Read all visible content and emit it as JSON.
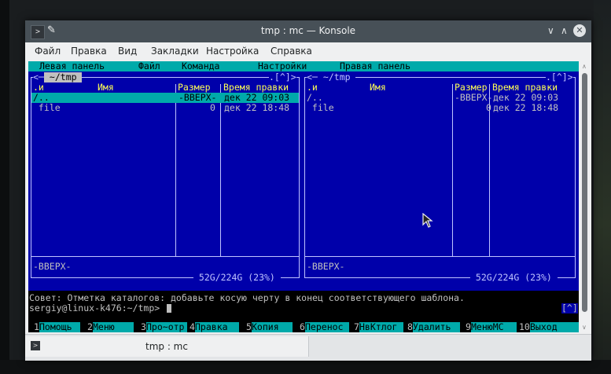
{
  "window": {
    "title": "tmp : mc — Konsole",
    "buttons": {
      "minimize": "∨",
      "maximize": "∧",
      "close": "✕"
    }
  },
  "menubar": [
    "Файл",
    "Правка",
    "Вид",
    "Закладки",
    "Настройка",
    "Справка"
  ],
  "mc": {
    "top_menu": [
      "Левая панель",
      "Файл",
      "Команда",
      "Настройки",
      "Правая панель"
    ],
    "left_panel": {
      "path": " ~/tmp ",
      "nav": ".[^]>",
      "headers": {
        "sort": ".и",
        "name": "Имя",
        "size": "Размер",
        "time": "Время правки"
      },
      "rows": [
        {
          "name": "/..",
          "size": "-ВВЕРХ-",
          "time": "дек 22 09:03"
        },
        {
          "name": " file",
          "size": "0",
          "time": "дек 22 18:48"
        }
      ],
      "status": "-ВВЕРХ-",
      "disk": " 52G/224G (23%) "
    },
    "right_panel": {
      "path": " ~/tmp ",
      "nav": ".[^]>",
      "headers": {
        "sort": ".и",
        "name": "Имя",
        "size": "Размер",
        "time": "Время правки"
      },
      "rows": [
        {
          "name": "/..",
          "size": "-ВВЕРХ-",
          "time": "дек 22 09:03"
        },
        {
          "name": " file",
          "size": "0",
          "time": "дек 22 18:48"
        }
      ],
      "status": "-ВВЕРХ-",
      "disk": " 52G/224G (23%) "
    },
    "hint": "Совет: Отметка каталогов: добавьте косую черту в конец соответствующего шаблона.",
    "prompt": "sergiy@linux-k476:~/tmp>",
    "prompt_right": "[^]",
    "fkeys": [
      {
        "num": "1",
        "label": "Помощь"
      },
      {
        "num": "2",
        "label": "Меню"
      },
      {
        "num": "3",
        "label": "Про~отр"
      },
      {
        "num": "4",
        "label": "Правка"
      },
      {
        "num": "5",
        "label": "Копия"
      },
      {
        "num": "6",
        "label": "Перенос"
      },
      {
        "num": "7",
        "label": "НвКтлог"
      },
      {
        "num": "8",
        "label": "Удалить"
      },
      {
        "num": "9",
        "label": "МенюMC"
      },
      {
        "num": "10",
        "label": "Выход"
      }
    ]
  },
  "tab": {
    "label": "tmp : mc"
  },
  "colors": {
    "panel_bg": "#0000aa",
    "cyan": "#00aaaa",
    "selected": "#00aaaa",
    "titlebar": "#475057"
  }
}
